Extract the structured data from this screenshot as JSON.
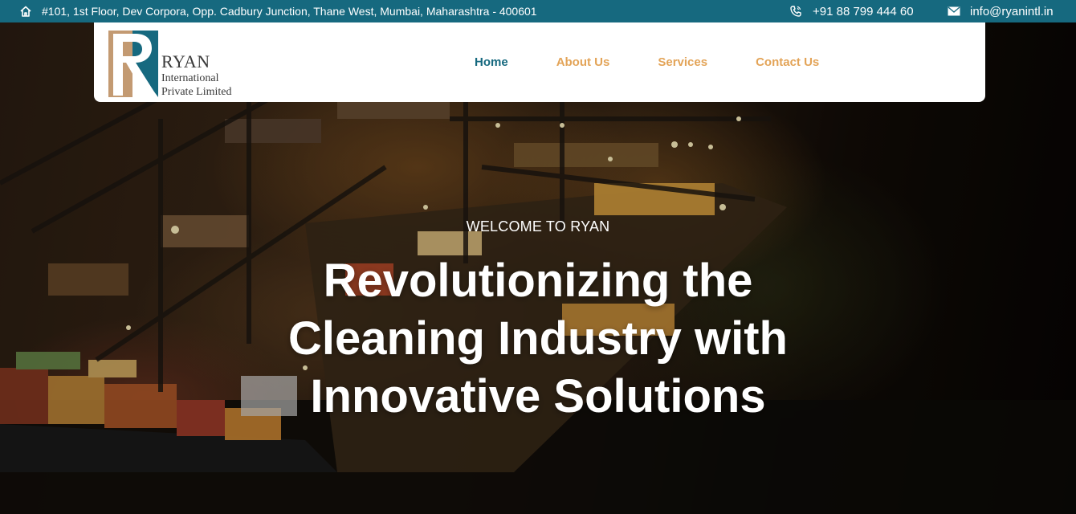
{
  "topbar": {
    "address": "#101, 1st Floor, Dev Corpora, Opp. Cadbury Junction, Thane West, Mumbai, Maharashtra - 400601",
    "phone": "+91 88 799 444 60",
    "email": "info@ryanintl.in",
    "icons": [
      "home-icon",
      "phone-icon",
      "mail-icon"
    ]
  },
  "logo": {
    "name_line1": "RYAN",
    "name_line2": "International",
    "name_line3": "Private Limited"
  },
  "nav": {
    "items": [
      {
        "label": "Home",
        "active": true
      },
      {
        "label": "About Us",
        "active": false
      },
      {
        "label": "Services",
        "active": false
      },
      {
        "label": "Contact Us",
        "active": false
      }
    ]
  },
  "hero": {
    "kicker": "WELCOME TO RYAN",
    "headline_line1": "Revolutionizing the",
    "headline_line2": "Cleaning Industry with",
    "headline_line3": "Innovative Solutions"
  },
  "colors": {
    "brand_teal": "#16697f",
    "accent_gold": "#e3a458",
    "logo_tan": "#c39a72"
  }
}
